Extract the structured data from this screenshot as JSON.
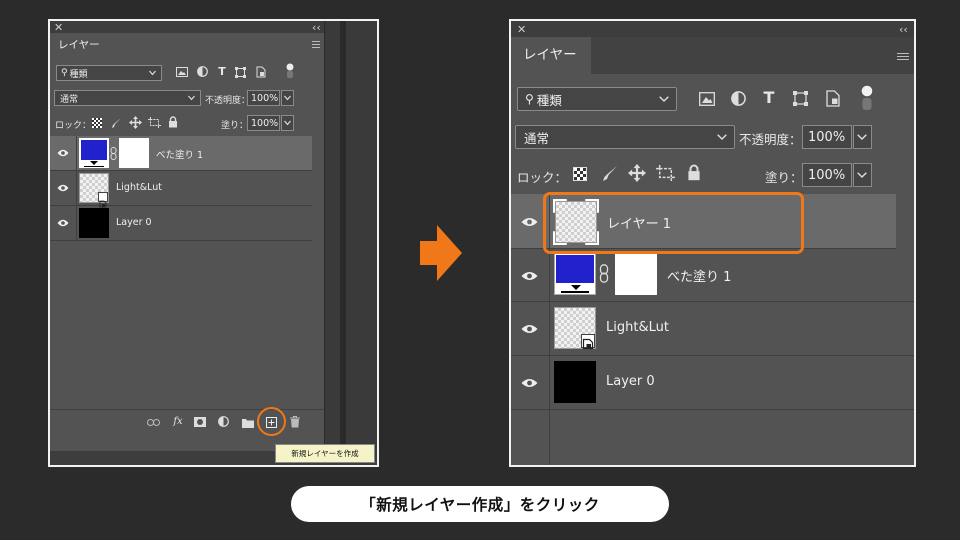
{
  "left_panel": {
    "tab": "レイヤー",
    "kind_filter": "種類",
    "blend_mode": "通常",
    "opacity_label": "不透明度：",
    "opacity_value": "100%",
    "lock_label": "ロック：",
    "fill_label": "塗り：",
    "fill_value": "100%",
    "layers": [
      {
        "name": "べた塗り 1",
        "thumb": "solid-fill",
        "selected": true
      },
      {
        "name": "Light&Lut",
        "thumb": "smart-object",
        "selected": false
      },
      {
        "name": "Layer 0",
        "thumb": "black",
        "selected": false
      }
    ],
    "footer_icons": [
      "link-icon",
      "fx-icon",
      "mask-icon",
      "adjustment-icon",
      "folder-icon",
      "new-layer-icon",
      "trash-icon"
    ],
    "fx_label": "fx",
    "tooltip": "新規レイヤーを作成"
  },
  "right_panel": {
    "tab": "レイヤー",
    "kind_filter": "種類",
    "blend_mode": "通常",
    "opacity_label": "不透明度：",
    "opacity_value": "100%",
    "lock_label": "ロック：",
    "fill_label": "塗り：",
    "fill_value": "100%",
    "layers": [
      {
        "name": "レイヤー 1",
        "thumb": "transparent",
        "selected": true
      },
      {
        "name": "べた塗り 1",
        "thumb": "solid-fill",
        "selected": false
      },
      {
        "name": "Light&Lut",
        "thumb": "smart-object",
        "selected": false
      },
      {
        "name": "Layer 0",
        "thumb": "black",
        "selected": false
      }
    ]
  },
  "caption": "「新規レイヤー作成」をクリック",
  "colors": {
    "highlight": "#f07818",
    "arrow": "#f07818",
    "fill_color": "#2222cc",
    "panel_bg": "#535353",
    "page_bg": "#2b2b2b"
  }
}
